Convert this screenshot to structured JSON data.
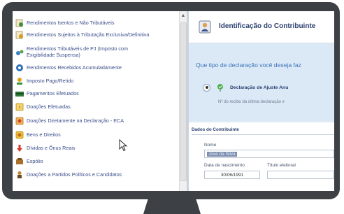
{
  "menu": {
    "items": [
      {
        "label": "Rendimentos Isentos e Não Tributáveis",
        "icon": "income-exempt-icon"
      },
      {
        "label": "Rendimentos Sujeitos à Tributação Exclusiva/Definitiva",
        "icon": "income-exclusive-icon"
      },
      {
        "label": "Rendimentos Tributáveis de PJ (Imposto com Exigibilidade Suspensa)",
        "icon": "income-suspended-icon"
      },
      {
        "label": "Rendimentos Recebidos Acumuladamente",
        "icon": "income-accumulated-icon"
      },
      {
        "label": "Imposto Pago/Retido",
        "icon": "tax-paid-icon"
      },
      {
        "label": "Pagamentos Efetuados",
        "icon": "payments-icon"
      },
      {
        "label": "Doações Efetuadas",
        "icon": "donations-icon"
      },
      {
        "label": "Doações Diretamente na Declaração - ECA",
        "icon": "donations-eca-icon"
      },
      {
        "label": "Bens e Direitos",
        "icon": "assets-icon"
      },
      {
        "label": "Dívidas e Ônus Reais",
        "icon": "debts-icon"
      },
      {
        "label": "Espólio",
        "icon": "estate-icon"
      },
      {
        "label": "Doações a Partidos Políticos e Candidatos",
        "icon": "political-donations-icon"
      }
    ]
  },
  "header": {
    "title": "Identificação do Contribuinte"
  },
  "question": "Que tipo de declaração você deseja faz",
  "declaration_option": "Declaração de Ajuste Anu",
  "receipt_label": "Nº do recibo da última declaração e",
  "section_title": "Dados do Contribuinte",
  "fields": {
    "name_label": "Nome",
    "name_value": "José da Silva",
    "birth_label": "Data de nascimento",
    "birth_value": "30/06/1991",
    "voter_label": "Título eleitoral",
    "voter_value": ""
  },
  "colors": {
    "bezel": "#3d4044",
    "accent": "#3c73b8",
    "blue_area": "#dbe9f7"
  }
}
